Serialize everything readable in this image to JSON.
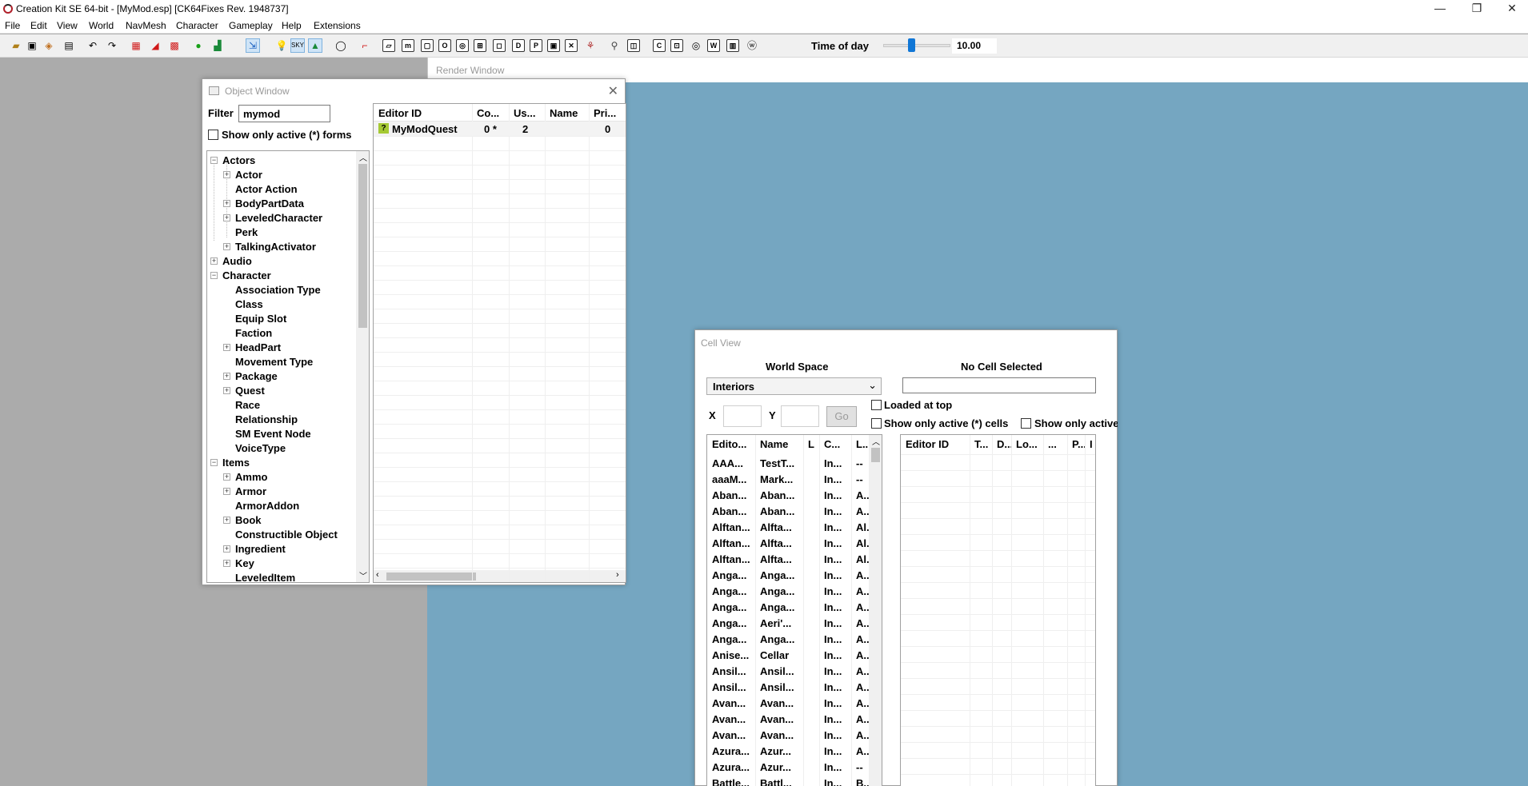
{
  "app": {
    "title": "Creation Kit SE 64-bit - [MyMod.esp] [CK64Fixes Rev. 1948737]",
    "menu": [
      "File",
      "Edit",
      "View",
      "World",
      "NavMesh",
      "Character",
      "Gameplay",
      "Help",
      "Extensions"
    ],
    "window_buttons": [
      "—",
      "❐",
      "✕"
    ]
  },
  "toolbar": {
    "time_of_day_label": "Time of day",
    "time_of_day_value": "10.00",
    "time_of_day_fraction": 0.42,
    "icons": [
      "open-icon",
      "save-icon",
      "data-files-icon",
      "preferences-icon",
      "undo-icon",
      "redo-icon",
      "marker-icon",
      "navmesh-icon",
      "grid-icon",
      "landscape-icon",
      "paint-icon",
      "collision-icon",
      "lighting-icon",
      "sky-icon",
      "terrain-icon",
      "dialog-icon",
      "graph-icon"
    ]
  },
  "render_window": {
    "title": "Render Window"
  },
  "object_window": {
    "title": "Object Window",
    "filter_label": "Filter",
    "filter_value": "mymod",
    "show_active_label": "Show only active (*) forms",
    "tree": [
      {
        "label": "Actors",
        "level": 0,
        "exp": "−"
      },
      {
        "label": "Actor",
        "level": 1,
        "exp": "+"
      },
      {
        "label": "Actor Action",
        "level": 1,
        "exp": ""
      },
      {
        "label": "BodyPartData",
        "level": 1,
        "exp": "+"
      },
      {
        "label": "LeveledCharacter",
        "level": 1,
        "exp": "+"
      },
      {
        "label": "Perk",
        "level": 1,
        "exp": ""
      },
      {
        "label": "TalkingActivator",
        "level": 1,
        "exp": "+"
      },
      {
        "label": "Audio",
        "level": 0,
        "exp": "+"
      },
      {
        "label": "Character",
        "level": 0,
        "exp": "−"
      },
      {
        "label": "Association Type",
        "level": 1,
        "exp": ""
      },
      {
        "label": "Class",
        "level": 1,
        "exp": ""
      },
      {
        "label": "Equip Slot",
        "level": 1,
        "exp": ""
      },
      {
        "label": "Faction",
        "level": 1,
        "exp": ""
      },
      {
        "label": "HeadPart",
        "level": 1,
        "exp": "+"
      },
      {
        "label": "Movement Type",
        "level": 1,
        "exp": ""
      },
      {
        "label": "Package",
        "level": 1,
        "exp": "+"
      },
      {
        "label": "Quest",
        "level": 1,
        "exp": "+"
      },
      {
        "label": "Race",
        "level": 1,
        "exp": ""
      },
      {
        "label": "Relationship",
        "level": 1,
        "exp": ""
      },
      {
        "label": "SM Event Node",
        "level": 1,
        "exp": ""
      },
      {
        "label": "VoiceType",
        "level": 1,
        "exp": ""
      },
      {
        "label": "Items",
        "level": 0,
        "exp": "−"
      },
      {
        "label": "Ammo",
        "level": 1,
        "exp": "+"
      },
      {
        "label": "Armor",
        "level": 1,
        "exp": "+"
      },
      {
        "label": "ArmorAddon",
        "level": 1,
        "exp": ""
      },
      {
        "label": "Book",
        "level": 1,
        "exp": "+"
      },
      {
        "label": "Constructible Object",
        "level": 1,
        "exp": ""
      },
      {
        "label": "Ingredient",
        "level": 1,
        "exp": "+"
      },
      {
        "label": "Key",
        "level": 1,
        "exp": "+"
      },
      {
        "label": "LeveledItem",
        "level": 1,
        "exp": ""
      }
    ],
    "list_columns": [
      "Editor ID",
      "Co...",
      "Us...",
      "Name",
      "Pri..."
    ],
    "list_rows": [
      {
        "icon": "?",
        "editor_id": "MyModQuest",
        "count": "0 *",
        "users": "2",
        "name": "",
        "priority": "0"
      }
    ]
  },
  "cell_view": {
    "title": "Cell View",
    "world_space_label": "World Space",
    "world_space_value": "Interiors",
    "no_cell_label": "No Cell Selected",
    "x_label": "X",
    "y_label": "Y",
    "go_label": "Go",
    "loaded_at_top_label": "Loaded at top",
    "show_active_cells_label": "Show only active (*) cells",
    "show_only_active_label": "Show only active",
    "cells_columns": [
      "Edito...",
      "Name",
      "L",
      "C...",
      "L..."
    ],
    "cells_rows": [
      [
        "AAA...",
        "TestT...",
        "",
        "In...",
        "--"
      ],
      [
        "aaaM...",
        "Mark...",
        "",
        "In...",
        "--"
      ],
      [
        "Aban...",
        "Aban...",
        "",
        "In...",
        "A..."
      ],
      [
        "Aban...",
        "Aban...",
        "",
        "In...",
        "A..."
      ],
      [
        "Alftan...",
        "Alfta...",
        "",
        "In...",
        "Al."
      ],
      [
        "Alftan...",
        "Alfta...",
        "",
        "In...",
        "Al."
      ],
      [
        "Alftan...",
        "Alfta...",
        "",
        "In...",
        "Al."
      ],
      [
        "Anga...",
        "Anga...",
        "",
        "In...",
        "A..."
      ],
      [
        "Anga...",
        "Anga...",
        "",
        "In...",
        "A..."
      ],
      [
        "Anga...",
        "Anga...",
        "",
        "In...",
        "A..."
      ],
      [
        "Anga...",
        "Aeri'...",
        "",
        "In...",
        "A..."
      ],
      [
        "Anga...",
        "Anga...",
        "",
        "In...",
        "A..."
      ],
      [
        "Anise...",
        "Cellar",
        "",
        "In...",
        "A..."
      ],
      [
        "Ansil...",
        "Ansil...",
        "",
        "In...",
        "A..."
      ],
      [
        "Ansil...",
        "Ansil...",
        "",
        "In...",
        "A..."
      ],
      [
        "Avan...",
        "Avan...",
        "",
        "In...",
        "A..."
      ],
      [
        "Avan...",
        "Avan...",
        "",
        "In...",
        "A..."
      ],
      [
        "Avan...",
        "Avan...",
        "",
        "In...",
        "A..."
      ],
      [
        "Azura...",
        "Azur...",
        "",
        "In...",
        "A..."
      ],
      [
        "Azura...",
        "Azur...",
        "",
        "In...",
        "--"
      ],
      [
        "Battle...",
        "Battl...",
        "",
        "In...",
        "B..."
      ]
    ],
    "refs_columns": [
      "Editor ID",
      "T...",
      "D...",
      "Lo...",
      "...",
      "P...",
      "I"
    ]
  }
}
